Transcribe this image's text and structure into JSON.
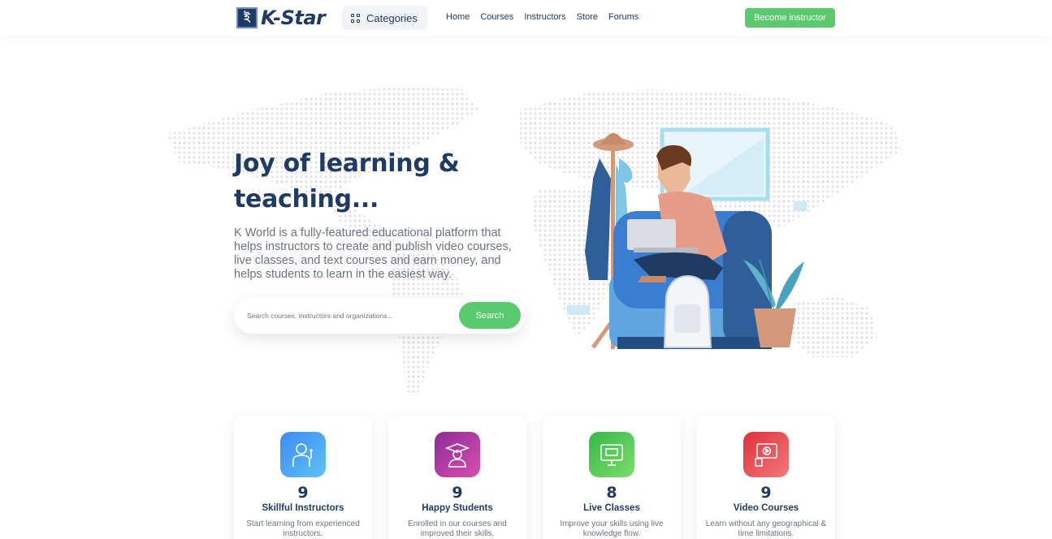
{
  "header": {
    "logo_text": "K-Star",
    "logo_glyph": "ই",
    "categories_label": "Categories",
    "nav": [
      "Home",
      "Courses",
      "Instructors",
      "Store",
      "Forums"
    ],
    "cta_label": "Become instructor"
  },
  "hero": {
    "title_line1": "Joy of learning &",
    "title_line2": "teaching...",
    "description": "K World is a fully-featured educational platform that helps instructors to create and publish video courses, live classes, and text courses and earn money, and helps students to learn in the easiest way.",
    "search_placeholder": "Search courses, instructors and organizations...",
    "search_button": "Search"
  },
  "stats": [
    {
      "count": "9",
      "title": "Skillful Instructors",
      "desc": "Start learning from experienced instructors.",
      "icon": "instructor-icon",
      "color": "#2f80ed"
    },
    {
      "count": "9",
      "title": "Happy Students",
      "desc": "Enrolled in our courses and improved their skills.",
      "icon": "graduate-icon",
      "color": "#a23d9e"
    },
    {
      "count": "8",
      "title": "Live Classes",
      "desc": "Improve your skills using live knowledge flow.",
      "icon": "live-class-icon",
      "color": "#3fbf4a"
    },
    {
      "count": "9",
      "title": "Video Courses",
      "desc": "Learn without any geographical & time limitations.",
      "icon": "video-course-icon",
      "color": "#e23d3d"
    }
  ],
  "colors": {
    "primary": "#1f3b64",
    "accent": "#5bc96d"
  }
}
